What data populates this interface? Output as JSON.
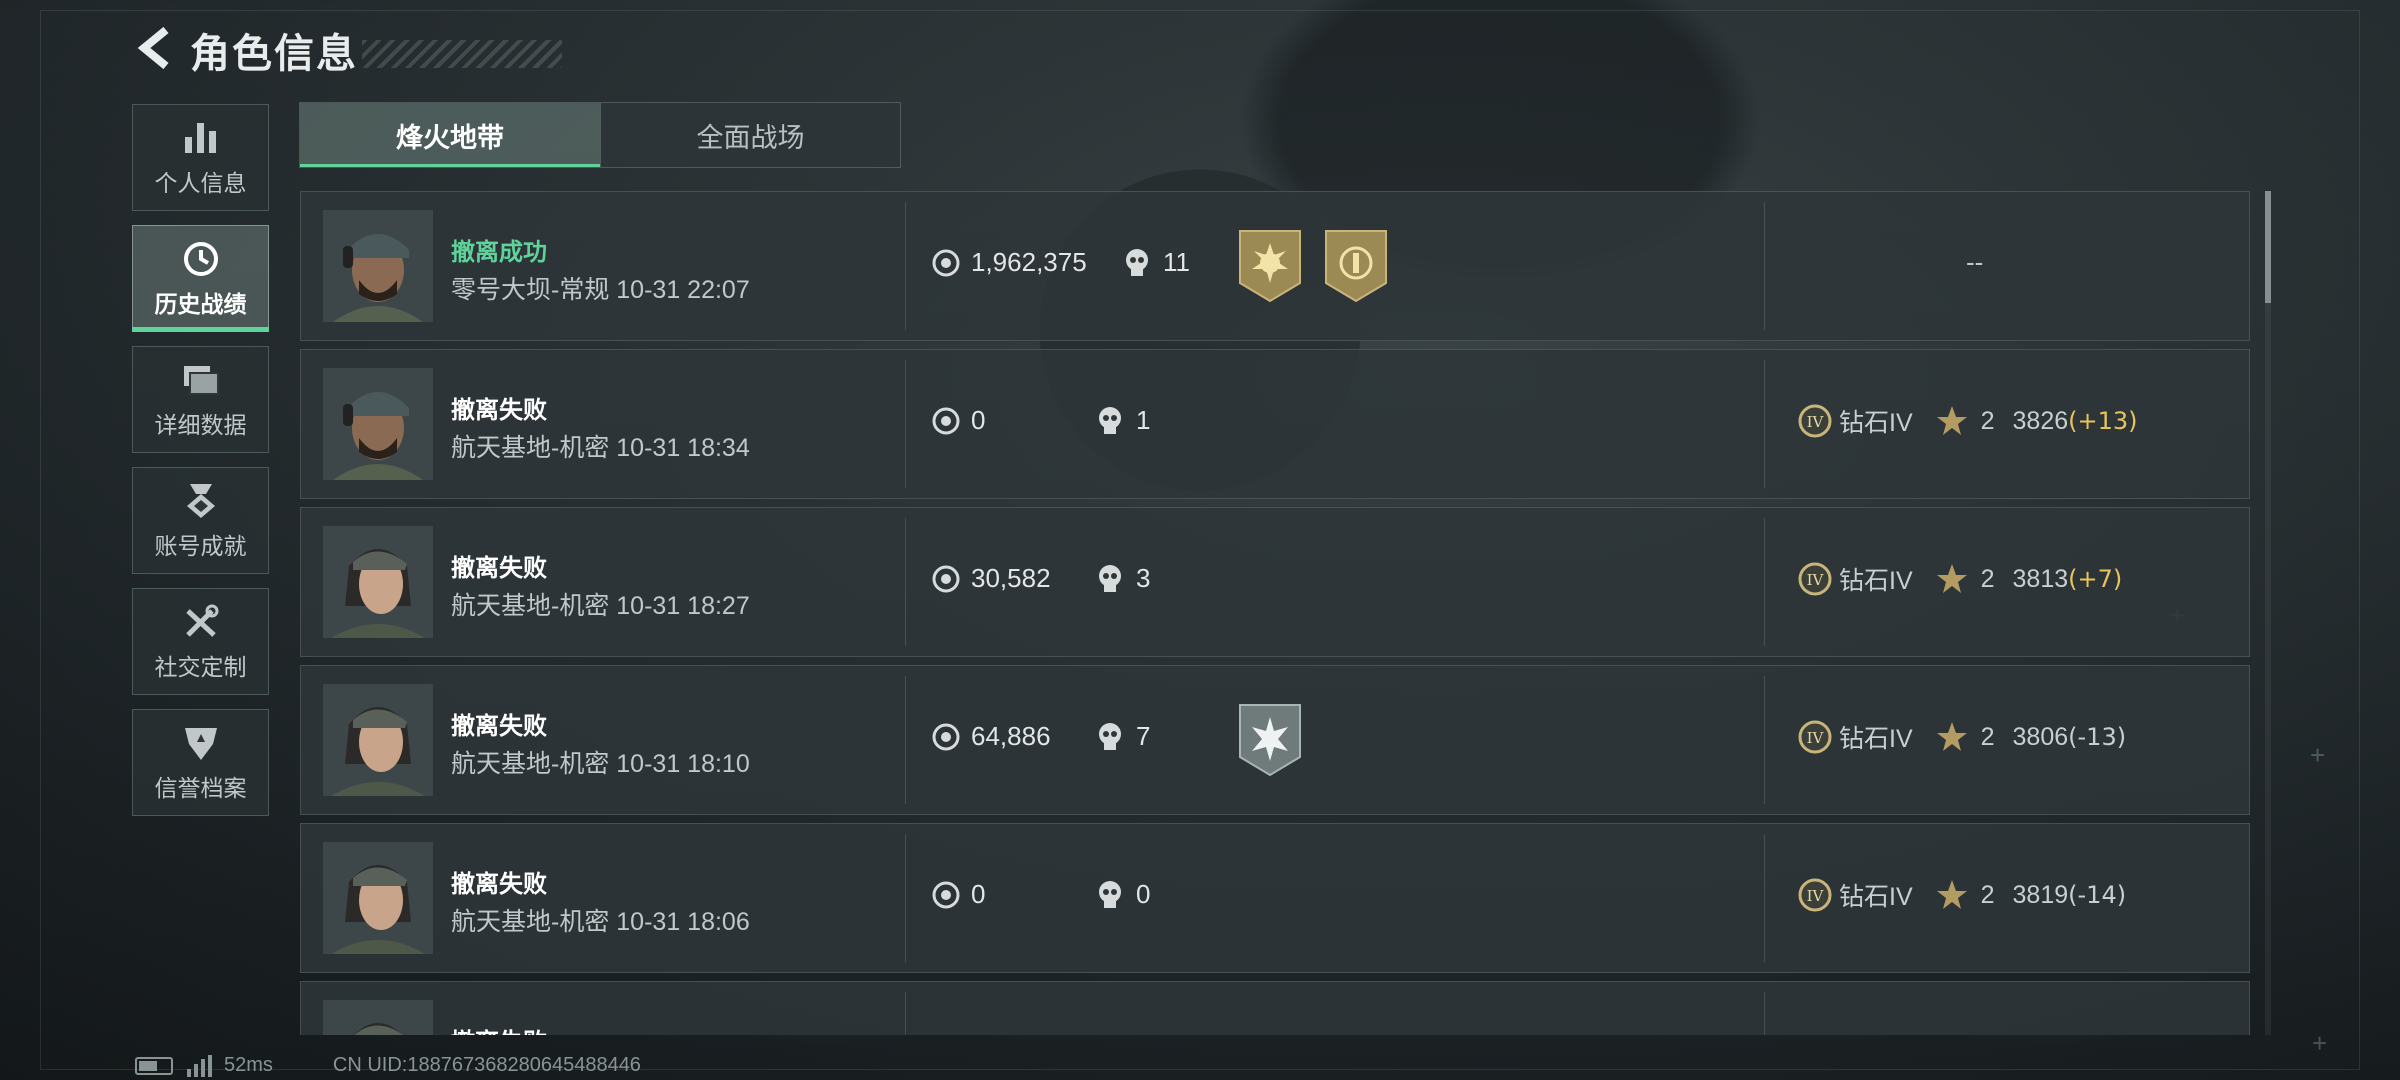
{
  "header": {
    "title": "角色信息",
    "back_icon": "chevron-left-icon"
  },
  "sidebar": {
    "items": [
      {
        "label": "个人信息",
        "icon": "bar-chart-icon",
        "active": false
      },
      {
        "label": "历史战绩",
        "icon": "history-clock-icon",
        "active": true
      },
      {
        "label": "详细数据",
        "icon": "folders-icon",
        "active": false
      },
      {
        "label": "账号成就",
        "icon": "medal-icon",
        "active": false
      },
      {
        "label": "社交定制",
        "icon": "tools-icon",
        "active": false
      },
      {
        "label": "信誉档案",
        "icon": "shield-icon",
        "active": false
      }
    ]
  },
  "tabs": [
    {
      "label": "烽火地带",
      "active": true
    },
    {
      "label": "全面战场",
      "active": false
    }
  ],
  "matches": [
    {
      "result": "撤离成功",
      "success": true,
      "map": "零号大坝-常规",
      "time": "10-31 22:07",
      "money": "1,962,375",
      "kills": "11",
      "badges": [
        "gold-sun-badge",
        "gold-emblem-badge"
      ],
      "rank": "--"
    },
    {
      "result": "撤离失败",
      "success": false,
      "map": "航天基地-机密",
      "time": "10-31 18:34",
      "money": "0",
      "kills": "1",
      "badges": [],
      "tier": "钻石IV",
      "stars": "2",
      "score": "3826",
      "delta": "(+13)"
    },
    {
      "result": "撤离失败",
      "success": false,
      "map": "航天基地-机密",
      "time": "10-31 18:27",
      "money": "30,582",
      "kills": "3",
      "badges": [],
      "tier": "钻石IV",
      "stars": "2",
      "score": "3813",
      "delta": "(+7)"
    },
    {
      "result": "撤离失败",
      "success": false,
      "map": "航天基地-机密",
      "time": "10-31 18:10",
      "money": "64,886",
      "kills": "7",
      "badges": [
        "silver-burst-badge"
      ],
      "tier": "钻石IV",
      "stars": "2",
      "score": "3806",
      "delta": "(-13)"
    },
    {
      "result": "撤离失败",
      "success": false,
      "map": "航天基地-机密",
      "time": "10-31 18:06",
      "money": "0",
      "kills": "0",
      "badges": [],
      "tier": "钻石IV",
      "stars": "2",
      "score": "3819",
      "delta": "(-14)"
    },
    {
      "result": "撤离失败",
      "success": false
    }
  ],
  "footer": {
    "ping": "52ms",
    "uid": "CN UID:1887673682806454884​46"
  },
  "colors": {
    "accent_green": "#5fd39a",
    "delta_up": "#e9c45a"
  }
}
